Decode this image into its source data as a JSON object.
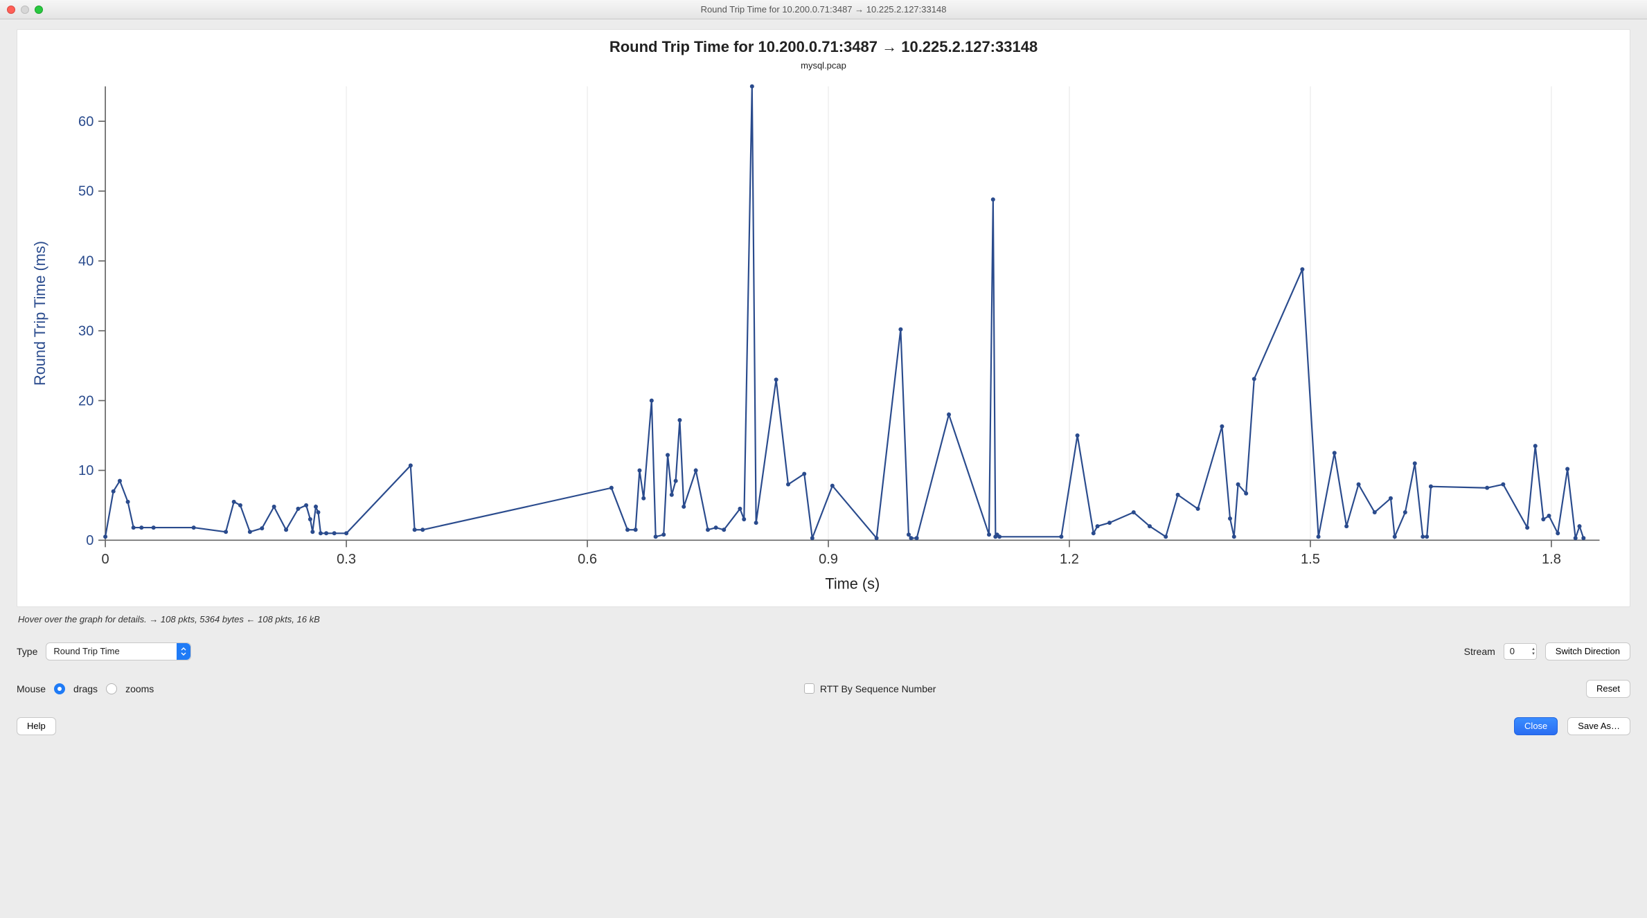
{
  "window": {
    "title": "Round Trip Time for 10.200.0.71:3487 → 10.225.2.127:33148"
  },
  "chart_data": {
    "type": "line",
    "title": "Round Trip Time for 10.200.0.71:3487 → 10.225.2.127:33148",
    "subtitle": "mysql.pcap",
    "xlabel": "Time (s)",
    "ylabel": "Round Trip Time (ms)",
    "xlim": [
      0,
      1.86
    ],
    "ylim": [
      0,
      65
    ],
    "x_ticks": [
      0,
      0.3,
      0.6,
      0.9,
      1.2,
      1.5,
      1.8
    ],
    "y_ticks": [
      0,
      10,
      20,
      30,
      40,
      50,
      60
    ],
    "series": [
      {
        "name": "RTT",
        "x": [
          0.0,
          0.01,
          0.018,
          0.028,
          0.035,
          0.045,
          0.06,
          0.11,
          0.15,
          0.16,
          0.168,
          0.18,
          0.195,
          0.21,
          0.225,
          0.24,
          0.25,
          0.255,
          0.258,
          0.262,
          0.265,
          0.268,
          0.275,
          0.285,
          0.3,
          0.38,
          0.385,
          0.395,
          0.63,
          0.65,
          0.66,
          0.665,
          0.67,
          0.68,
          0.685,
          0.695,
          0.7,
          0.705,
          0.71,
          0.715,
          0.72,
          0.735,
          0.75,
          0.76,
          0.77,
          0.79,
          0.795,
          0.805,
          0.81,
          0.835,
          0.85,
          0.87,
          0.88,
          0.905,
          0.96,
          0.99,
          1.0,
          1.003,
          1.01,
          1.05,
          1.1,
          1.105,
          1.108,
          1.11,
          1.113,
          1.19,
          1.21,
          1.23,
          1.235,
          1.25,
          1.28,
          1.3,
          1.32,
          1.335,
          1.36,
          1.39,
          1.4,
          1.405,
          1.41,
          1.42,
          1.43,
          1.49,
          1.51,
          1.53,
          1.545,
          1.56,
          1.58,
          1.6,
          1.605,
          1.618,
          1.63,
          1.64,
          1.645,
          1.65,
          1.72,
          1.74,
          1.77,
          1.78,
          1.79,
          1.797,
          1.808,
          1.82,
          1.83,
          1.835,
          1.84
        ],
        "y": [
          0.5,
          7.0,
          8.5,
          5.5,
          1.8,
          1.8,
          1.8,
          1.8,
          1.2,
          5.5,
          5.0,
          1.2,
          1.7,
          4.8,
          1.5,
          4.5,
          5.0,
          3.0,
          1.2,
          4.8,
          4.0,
          1.0,
          1.0,
          1.0,
          1.0,
          10.7,
          1.5,
          1.5,
          7.5,
          1.5,
          1.5,
          10.0,
          6.0,
          20.0,
          0.5,
          0.8,
          12.2,
          6.5,
          8.5,
          17.2,
          4.8,
          10.0,
          1.5,
          1.8,
          1.5,
          4.5,
          3.0,
          65.0,
          2.5,
          23.0,
          8.0,
          9.5,
          0.3,
          7.8,
          0.3,
          30.2,
          0.8,
          0.3,
          0.3,
          18.0,
          0.8,
          48.8,
          0.5,
          0.8,
          0.5,
          0.5,
          15.0,
          1.0,
          2.0,
          2.5,
          4.0,
          2.0,
          0.5,
          6.5,
          4.5,
          16.3,
          3.1,
          0.5,
          8.0,
          6.7,
          23.1,
          38.8,
          0.5,
          12.5,
          2.0,
          8.0,
          4.0,
          6.0,
          0.5,
          4.0,
          11.0,
          0.5,
          0.5,
          7.7,
          7.5,
          8.0,
          1.8,
          13.5,
          3.0,
          3.5,
          1.0,
          10.2,
          0.3,
          2.0,
          0.3
        ]
      }
    ]
  },
  "stats_line": "Hover over the graph for details. → 108 pkts, 5364 bytes ← 108 pkts, 16 kB",
  "controls": {
    "type_label": "Type",
    "type_value": "Round Trip Time",
    "stream_label": "Stream",
    "stream_value": "0",
    "switch_direction": "Switch Direction",
    "mouse_label": "Mouse",
    "mouse_opt_drags": "drags",
    "mouse_opt_zooms": "zooms",
    "mouse_selected": "drags",
    "rtt_seq_label": "RTT By Sequence Number",
    "rtt_seq_checked": false,
    "reset": "Reset",
    "help": "Help",
    "close": "Close",
    "save_as": "Save As…"
  }
}
